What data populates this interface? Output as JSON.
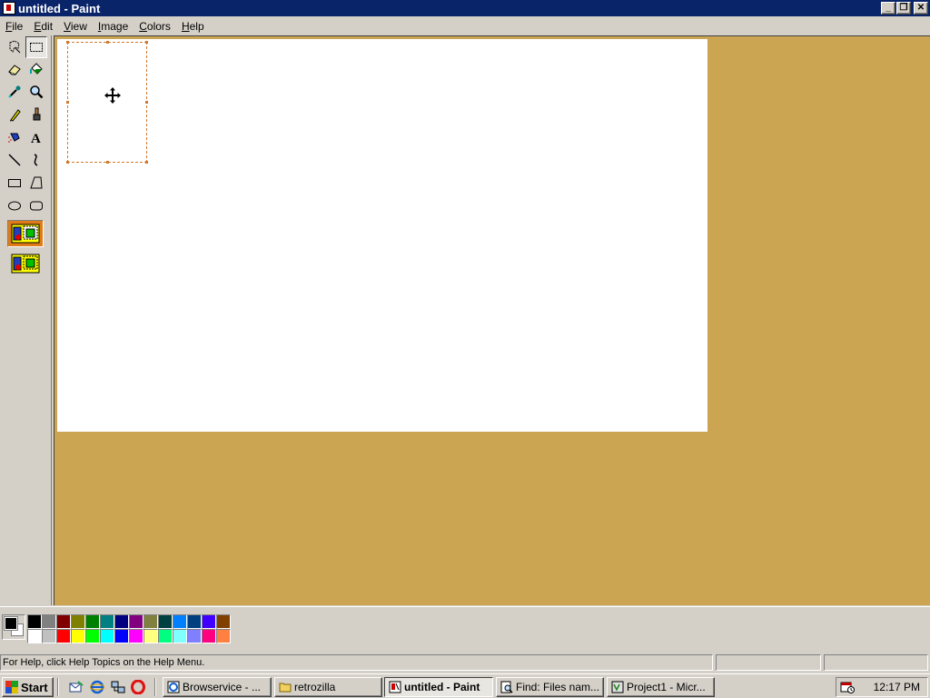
{
  "window": {
    "title": "untitled - Paint",
    "minimize_label": "_",
    "maximize_label": "❐",
    "close_label": "✕"
  },
  "menu": [
    {
      "accel": "F",
      "rest": "ile"
    },
    {
      "accel": "E",
      "rest": "dit"
    },
    {
      "accel": "V",
      "rest": "iew"
    },
    {
      "accel": "I",
      "rest": "mage"
    },
    {
      "accel": "C",
      "rest": "olors"
    },
    {
      "accel": "H",
      "rest": "elp"
    }
  ],
  "tools": [
    {
      "name": "free-form-select",
      "icon": "free-select-icon"
    },
    {
      "name": "select",
      "icon": "select-rect-icon",
      "pressed": true
    },
    {
      "name": "eraser",
      "icon": "eraser-icon"
    },
    {
      "name": "fill-with-color",
      "icon": "paint-bucket-icon"
    },
    {
      "name": "pick-color",
      "icon": "eyedropper-icon"
    },
    {
      "name": "magnifier",
      "icon": "magnifier-icon"
    },
    {
      "name": "pencil",
      "icon": "pencil-icon"
    },
    {
      "name": "brush",
      "icon": "brush-icon"
    },
    {
      "name": "airbrush",
      "icon": "airbrush-icon"
    },
    {
      "name": "text",
      "icon": "text-icon",
      "label": "A"
    },
    {
      "name": "line",
      "icon": "line-icon"
    },
    {
      "name": "curve",
      "icon": "curve-icon"
    },
    {
      "name": "rectangle",
      "icon": "rectangle-icon"
    },
    {
      "name": "polygon",
      "icon": "polygon-icon"
    },
    {
      "name": "ellipse",
      "icon": "ellipse-icon"
    },
    {
      "name": "rounded-rectangle",
      "icon": "rounded-rect-icon"
    }
  ],
  "selection_options": [
    {
      "name": "opaque-selection",
      "icon": "opaque-selection-icon",
      "selected": true
    },
    {
      "name": "transparent-selection",
      "icon": "transparent-selection-icon",
      "selected": false
    }
  ],
  "colors": {
    "foreground": "#000000",
    "background": "#ffffff",
    "workspace": "#cca552",
    "selection_outline": "#d07a30",
    "palette": [
      "#000000",
      "#808080",
      "#800000",
      "#808000",
      "#008000",
      "#008080",
      "#000080",
      "#800080",
      "#808040",
      "#004040",
      "#0080ff",
      "#004080",
      "#4000ff",
      "#804000",
      "#ffffff",
      "#c0c0c0",
      "#ff0000",
      "#ffff00",
      "#00ff00",
      "#00ffff",
      "#0000ff",
      "#ff00ff",
      "#ffff80",
      "#00ff80",
      "#80ffff",
      "#8080ff",
      "#ff0080",
      "#ff8040"
    ]
  },
  "status": {
    "help_text": "For Help, click Help Topics on the Help Menu."
  },
  "taskbar": {
    "start_label": "Start",
    "quick_launch": [
      "outlook-express-icon",
      "internet-explorer-icon",
      "network-icon",
      "opera-icon"
    ],
    "tasks": [
      {
        "label": "Browservice - ...",
        "icon": "ie-page-icon",
        "active": false
      },
      {
        "label": "retrozilla",
        "icon": "folder-icon",
        "active": false
      },
      {
        "label": "untitled - Paint",
        "icon": "paint-icon",
        "active": true
      },
      {
        "label": "Find: Files nam...",
        "icon": "find-icon",
        "active": false
      },
      {
        "label": "Project1 - Micr...",
        "icon": "vb-project-icon",
        "active": false
      }
    ],
    "clock": "12:17 PM"
  }
}
